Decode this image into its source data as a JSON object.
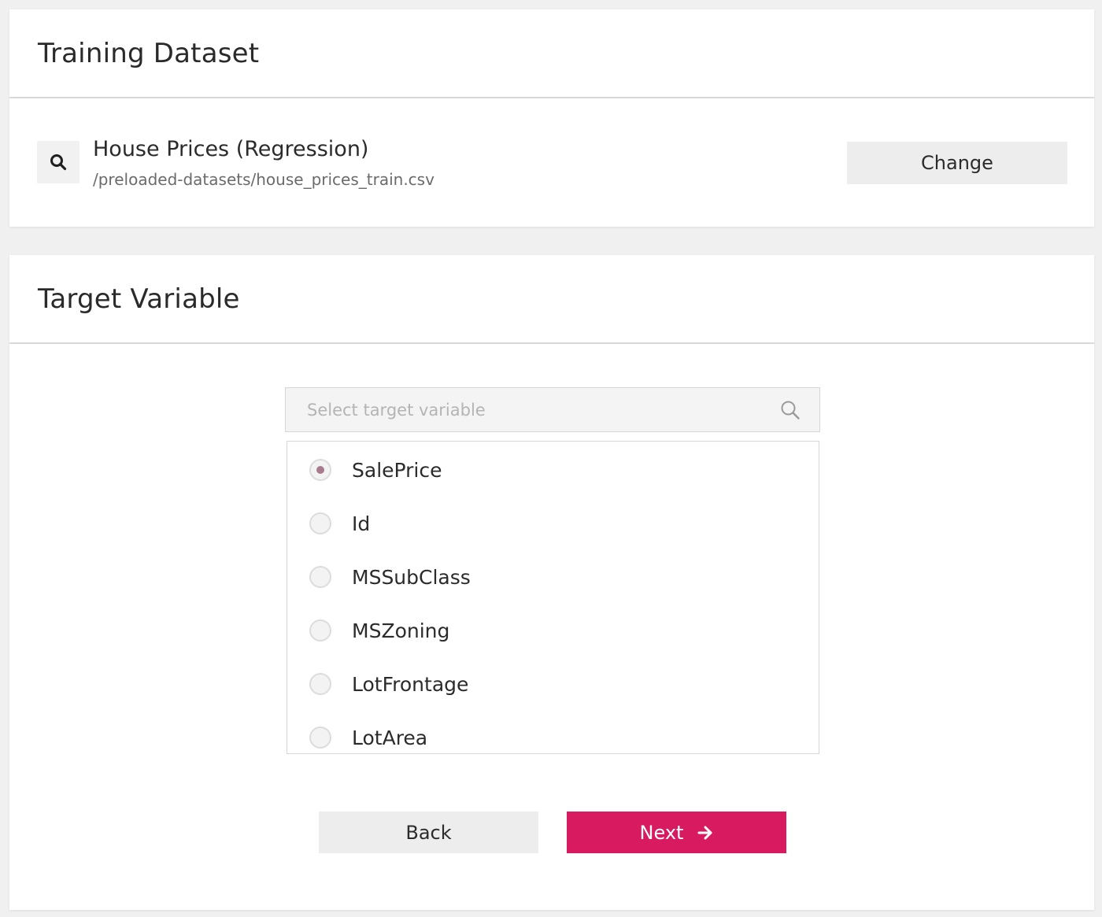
{
  "dataset_card": {
    "title": "Training Dataset",
    "dataset_name": "House Prices (Regression)",
    "dataset_path": "/preloaded-datasets/house_prices_train.csv",
    "change_label": "Change",
    "icon": "search-icon"
  },
  "target_card": {
    "title": "Target Variable",
    "search": {
      "placeholder": "Select target variable",
      "value": "",
      "icon": "search-icon"
    },
    "options": [
      {
        "label": "SalePrice",
        "selected": true
      },
      {
        "label": "Id",
        "selected": false
      },
      {
        "label": "MSSubClass",
        "selected": false
      },
      {
        "label": "MSZoning",
        "selected": false
      },
      {
        "label": "LotFrontage",
        "selected": false
      },
      {
        "label": "LotArea",
        "selected": false
      }
    ],
    "back_label": "Back",
    "next_label": "Next",
    "next_icon": "arrow-right-icon"
  },
  "colors": {
    "accent": "#d81b60",
    "background": "#f0f0f0",
    "button_grey": "#ededed"
  }
}
